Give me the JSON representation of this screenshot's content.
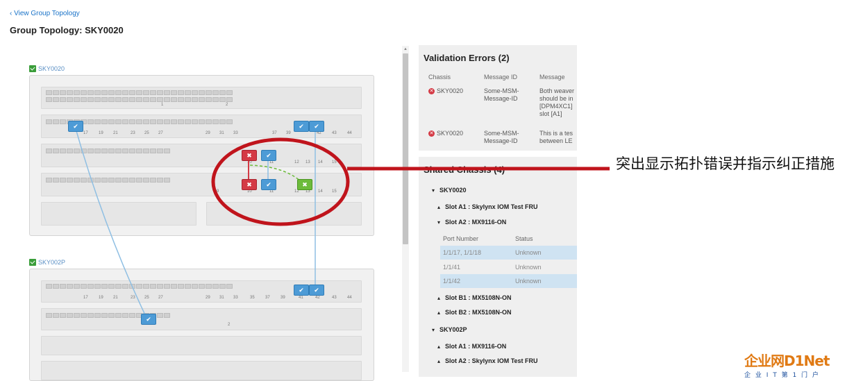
{
  "header": {
    "back_link": "‹ View Group Topology",
    "title": "Group Topology: SKY0020"
  },
  "topology": {
    "chassis": [
      {
        "name": "SKY0020",
        "row1_slots": [
          "1",
          "2"
        ],
        "row2_ports": [
          "17",
          "19",
          "21",
          "23",
          "25",
          "27",
          "29",
          "31",
          "33",
          "37",
          "39",
          "42",
          "43",
          "44"
        ],
        "row3_ports": [
          "10",
          "11",
          "12",
          "13",
          "14",
          "15"
        ],
        "row4_ports": [
          "9",
          "10",
          "11",
          "12",
          "13",
          "14",
          "15"
        ]
      },
      {
        "name": "SKY002P",
        "row1_ports": [
          "17",
          "19",
          "21",
          "23",
          "25",
          "27",
          "29",
          "31",
          "33",
          "35",
          "37",
          "39",
          "41",
          "42",
          "43",
          "44"
        ],
        "row2_slots": [
          "2"
        ]
      }
    ],
    "colors": {
      "ok": "#4d9bd6",
      "error": "#d43a45",
      "fix": "#6cbb3b",
      "link": "#8fbfe3",
      "highlight": "#c0141c"
    }
  },
  "validation": {
    "title": "Validation Errors (2)",
    "columns": [
      "Chassis",
      "Message ID",
      "Message"
    ],
    "rows": [
      {
        "chassis": "SKY0020",
        "message_id": [
          "Some-MSM-",
          "Message-ID"
        ],
        "message": [
          "Both weaver",
          "should be in",
          "[DPM4XC1]",
          "slot [A1]"
        ]
      },
      {
        "chassis": "SKY0020",
        "message_id": [
          "Some-MSM-",
          "Message-ID"
        ],
        "message": [
          "This is a tes",
          "between LE"
        ]
      }
    ]
  },
  "shared": {
    "title": "Shared Chassis (4)",
    "groups": [
      {
        "name": "SKY0020",
        "slots": [
          {
            "label": "Slot A1 : Skylynx IOM Test FRU",
            "expanded": false
          },
          {
            "label": "Slot A2 : MX9116-ON",
            "expanded": true,
            "port_columns": [
              "Port Number",
              "Status"
            ],
            "ports": [
              {
                "number": "1/1/17, 1/1/18",
                "status": "Unknown",
                "highlight": true
              },
              {
                "number": "1/1/41",
                "status": "Unknown",
                "highlight": false
              },
              {
                "number": "1/1/42",
                "status": "Unknown",
                "highlight": true
              }
            ]
          },
          {
            "label": "Slot B1 : MX5108N-ON",
            "expanded": false
          },
          {
            "label": "Slot B2 : MX5108N-ON",
            "expanded": false
          }
        ]
      },
      {
        "name": "SKY002P",
        "slots": [
          {
            "label": "Slot A1 : MX9116-ON",
            "expanded": false
          },
          {
            "label": "Slot A2 : Skylynx IOM Test FRU",
            "expanded": false
          }
        ]
      }
    ]
  },
  "annotation": {
    "text": "突出显示拓扑错误并指示纠正措施"
  },
  "watermark": {
    "logo": "企业网D1Net",
    "subtitle": "企 业 I T 第 1 门 户"
  }
}
